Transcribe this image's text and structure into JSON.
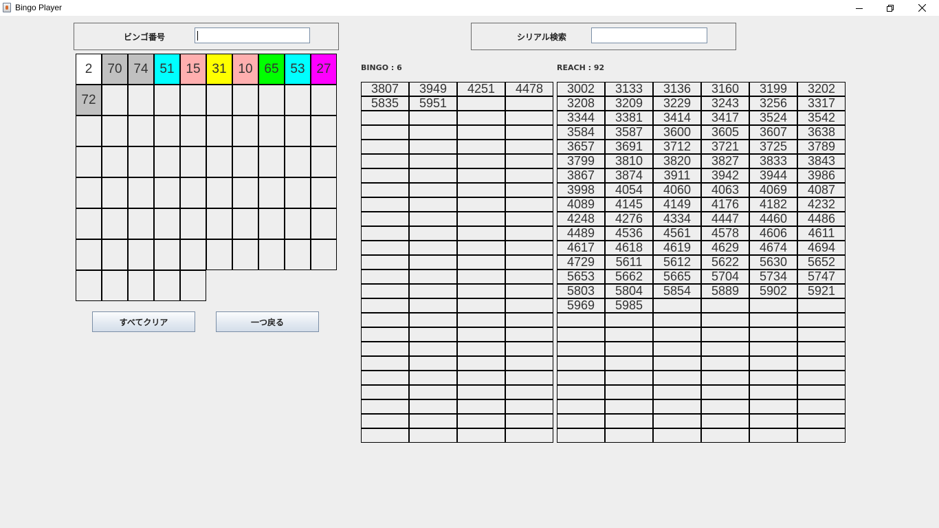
{
  "window": {
    "title": "Bingo Player",
    "controls": [
      "minimize",
      "restore",
      "close"
    ]
  },
  "bingo_input": {
    "label": "ビンゴ番号",
    "value": ""
  },
  "serial_search": {
    "label": "シリアル検索",
    "value": ""
  },
  "drawn_numbers": [
    {
      "value": "2",
      "color": "#ffffff"
    },
    {
      "value": "70",
      "color": "#c0c0c0"
    },
    {
      "value": "74",
      "color": "#c0c0c0"
    },
    {
      "value": "51",
      "color": "#00ffff"
    },
    {
      "value": "15",
      "color": "#ffafaf"
    },
    {
      "value": "31",
      "color": "#ffff00"
    },
    {
      "value": "10",
      "color": "#ffafaf"
    },
    {
      "value": "65",
      "color": "#00ff00"
    },
    {
      "value": "53",
      "color": "#00ffff"
    },
    {
      "value": "27",
      "color": "#ff00ff"
    },
    {
      "value": "72",
      "color": "#c0c0c0"
    }
  ],
  "bingo_grid": {
    "total_cells": 75,
    "columns": 10,
    "empty_color": "#eeeeee"
  },
  "buttons": {
    "clear_all": "すべてクリア",
    "undo": "一つ戻る"
  },
  "stats": {
    "bingo": "BINGO : 6",
    "reach": "REACH : 92"
  },
  "bingo_table": {
    "columns": 4,
    "rows": 25,
    "values": [
      "3807",
      "3949",
      "4251",
      "4478",
      "5835",
      "5951"
    ]
  },
  "reach_table": {
    "columns": 6,
    "rows": 25,
    "values": [
      "3002",
      "3133",
      "3136",
      "3160",
      "3199",
      "3202",
      "3208",
      "3209",
      "3229",
      "3243",
      "3256",
      "3317",
      "3344",
      "3381",
      "3414",
      "3417",
      "3524",
      "3542",
      "3584",
      "3587",
      "3600",
      "3605",
      "3607",
      "3638",
      "3657",
      "3691",
      "3712",
      "3721",
      "3725",
      "3789",
      "3799",
      "3810",
      "3820",
      "3827",
      "3833",
      "3843",
      "3867",
      "3874",
      "3911",
      "3942",
      "3944",
      "3986",
      "3998",
      "4054",
      "4060",
      "4063",
      "4069",
      "4087",
      "4089",
      "4145",
      "4149",
      "4176",
      "4182",
      "4232",
      "4248",
      "4276",
      "4334",
      "4447",
      "4460",
      "4486",
      "4489",
      "4536",
      "4561",
      "4578",
      "4606",
      "4611",
      "4617",
      "4618",
      "4619",
      "4629",
      "4674",
      "4694",
      "4729",
      "5611",
      "5612",
      "5622",
      "5630",
      "5652",
      "5653",
      "5662",
      "5665",
      "5704",
      "5734",
      "5747",
      "5803",
      "5804",
      "5854",
      "5889",
      "5902",
      "5921",
      "5969",
      "5985"
    ]
  }
}
